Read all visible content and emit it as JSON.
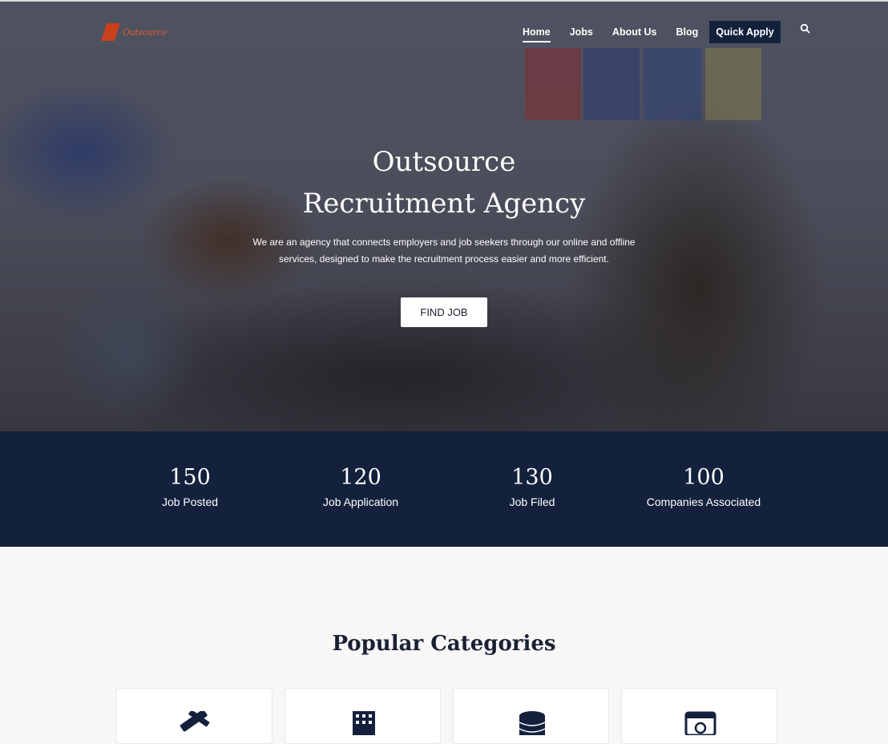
{
  "nav": {
    "logo_text": "Outsource",
    "items": [
      {
        "label": "Home",
        "active": true
      },
      {
        "label": "Jobs",
        "active": false
      },
      {
        "label": "About Us",
        "active": false
      },
      {
        "label": "Blog",
        "active": false
      }
    ],
    "quick_apply_label": "Quick Apply",
    "search_icon": "search-icon"
  },
  "hero": {
    "title_line1": "Outsource",
    "title_line2": "Recruitment Agency",
    "subtitle_line1": "We are an agency that connects employers and job seekers through our online and offline",
    "subtitle_line2": "services, designed to make the recruitment process easier and more efficient.",
    "button_label": "FIND JOB"
  },
  "stats": [
    {
      "value": "150",
      "label": "Job Posted"
    },
    {
      "value": "120",
      "label": "Job Application"
    },
    {
      "value": "130",
      "label": "Job Filed"
    },
    {
      "value": "100",
      "label": "Companies Associated"
    }
  ],
  "categories": {
    "title": "Popular Categories",
    "card_icons": [
      "pencil-ruler-icon",
      "building-icon",
      "database-icon",
      "browser-money-icon"
    ]
  },
  "colors": {
    "navy": "#14213d",
    "brand_orange": "#c8401c",
    "page_bg": "#f7f7f7"
  }
}
